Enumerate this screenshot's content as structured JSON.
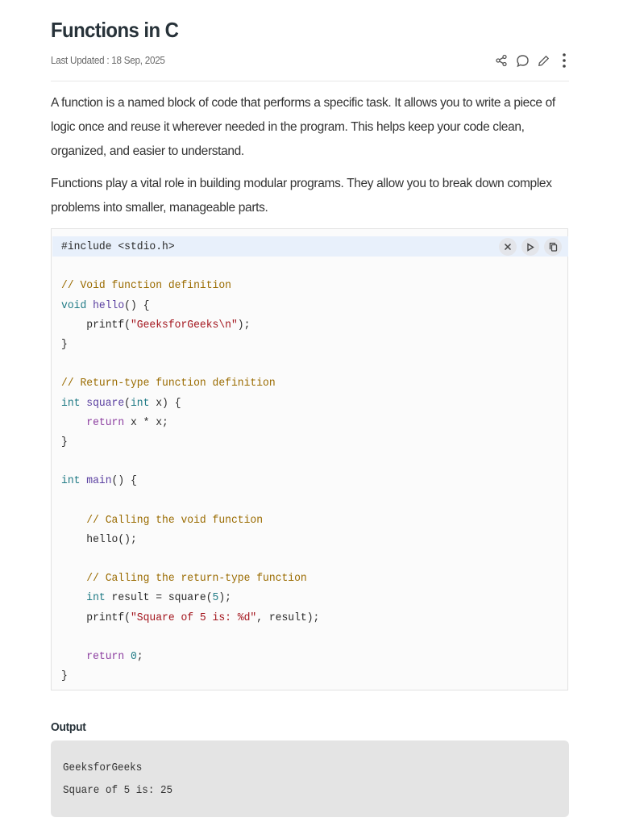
{
  "article": {
    "title": "Functions in C",
    "last_updated": "Last Updated : 18 Sep, 2025",
    "paragraphs": [
      "A function is a named block of code that performs a specific task. It allows you to write a piece of logic once and reuse it wherever needed in the program. This helps keep your code clean, organized, and easier to understand.",
      "Functions play a vital role in building modular programs. They allow you to break down complex problems into smaller, manageable parts."
    ]
  },
  "actions": {
    "icons": [
      "share-icon",
      "comment-icon",
      "edit-icon",
      "more-options-icon"
    ]
  },
  "code": {
    "language": "C",
    "toolbar_icons": [
      "close-icon",
      "run-icon",
      "copy-icon"
    ],
    "lines": [
      [
        {
          "t": "#include <stdio.h>",
          "c": ""
        }
      ],
      [],
      [
        {
          "t": "// Void function definition",
          "c": "cm"
        }
      ],
      [
        {
          "t": "void",
          "c": "kw"
        },
        {
          "t": " ",
          "c": ""
        },
        {
          "t": "hello",
          "c": "fn"
        },
        {
          "t": "() {",
          "c": ""
        }
      ],
      [
        {
          "t": "    printf(",
          "c": ""
        },
        {
          "t": "\"GeeksforGeeks\\n\"",
          "c": "st"
        },
        {
          "t": ");",
          "c": ""
        }
      ],
      [
        {
          "t": "}",
          "c": ""
        }
      ],
      [],
      [
        {
          "t": "// Return-type function definition",
          "c": "cm"
        }
      ],
      [
        {
          "t": "int",
          "c": "kw"
        },
        {
          "t": " ",
          "c": ""
        },
        {
          "t": "square",
          "c": "fn"
        },
        {
          "t": "(",
          "c": ""
        },
        {
          "t": "int",
          "c": "kw"
        },
        {
          "t": " x) {",
          "c": ""
        }
      ],
      [
        {
          "t": "    ",
          "c": ""
        },
        {
          "t": "return",
          "c": "ret"
        },
        {
          "t": " x * x;",
          "c": ""
        }
      ],
      [
        {
          "t": "}",
          "c": ""
        }
      ],
      [],
      [
        {
          "t": "int",
          "c": "kw"
        },
        {
          "t": " ",
          "c": ""
        },
        {
          "t": "main",
          "c": "fn"
        },
        {
          "t": "() {",
          "c": ""
        }
      ],
      [],
      [
        {
          "t": "    ",
          "c": ""
        },
        {
          "t": "// Calling the void function",
          "c": "cm"
        }
      ],
      [
        {
          "t": "    hello();",
          "c": ""
        }
      ],
      [],
      [
        {
          "t": "    ",
          "c": ""
        },
        {
          "t": "// Calling the return-type function",
          "c": "cm"
        }
      ],
      [
        {
          "t": "    ",
          "c": ""
        },
        {
          "t": "int",
          "c": "kw"
        },
        {
          "t": " result = square(",
          "c": ""
        },
        {
          "t": "5",
          "c": "nm"
        },
        {
          "t": ");",
          "c": ""
        }
      ],
      [
        {
          "t": "    printf(",
          "c": ""
        },
        {
          "t": "\"Square of 5 is: %d\"",
          "c": "st"
        },
        {
          "t": ", result);",
          "c": ""
        }
      ],
      [],
      [
        {
          "t": "    ",
          "c": ""
        },
        {
          "t": "return",
          "c": "ret"
        },
        {
          "t": " ",
          "c": ""
        },
        {
          "t": "0",
          "c": "nm"
        },
        {
          "t": ";",
          "c": ""
        }
      ],
      [
        {
          "t": "}",
          "c": ""
        }
      ]
    ]
  },
  "output": {
    "label": "Output",
    "lines": [
      "GeeksforGeeks",
      "Square of 5 is: 25"
    ]
  },
  "colors": {
    "comment": "#9a6b00",
    "keyword": "#1f7a85",
    "function": "#5a3fa0",
    "string": "#a3151d",
    "return": "#8d3fa0",
    "output_bg": "#e4e4e4",
    "code_highlight": "#e8f0fb"
  }
}
